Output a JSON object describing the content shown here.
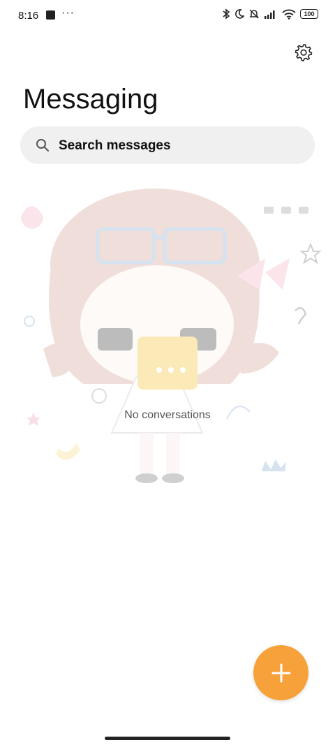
{
  "status_bar": {
    "time": "8:16",
    "notification_dots": "···",
    "battery": "100"
  },
  "header": {
    "title": "Messaging"
  },
  "search": {
    "placeholder": "Search messages"
  },
  "empty_state": {
    "text": "No conversations"
  },
  "colors": {
    "accent": "#f7a13b",
    "search_bg": "#f0f0f0"
  }
}
